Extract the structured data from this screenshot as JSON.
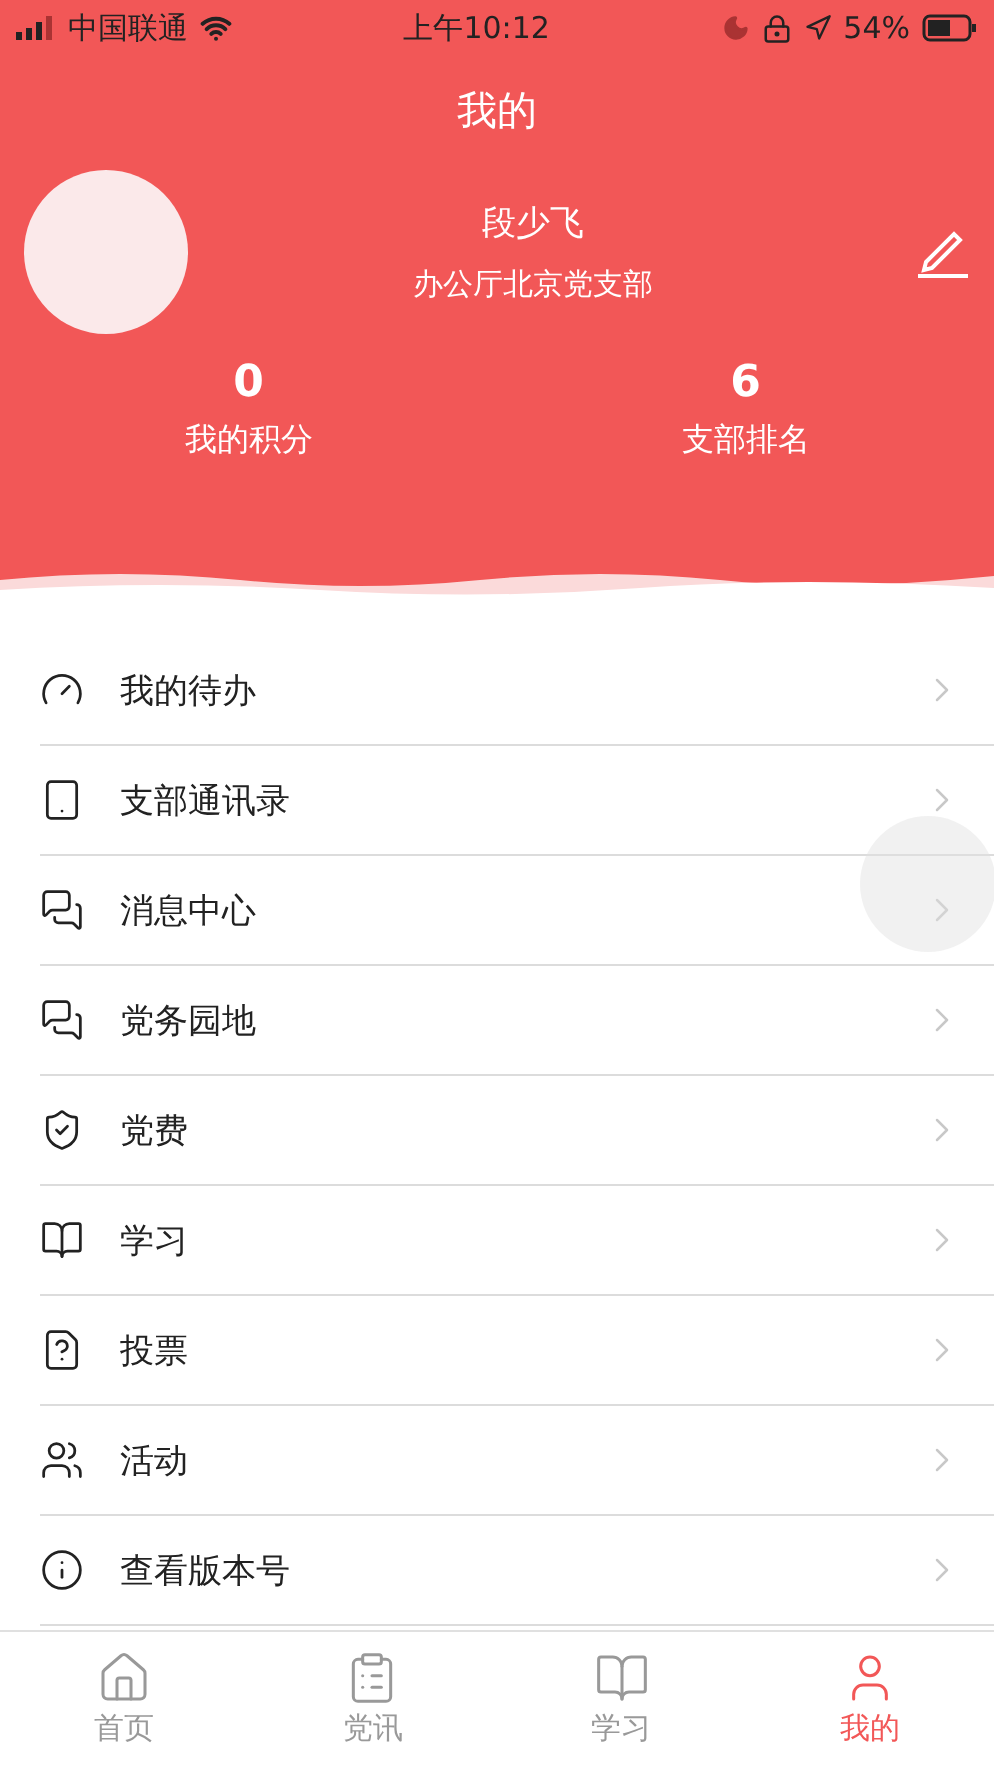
{
  "status_bar": {
    "carrier": "中国联通",
    "time": "上午10:12",
    "battery": "54%"
  },
  "header": {
    "title": "我的"
  },
  "profile": {
    "name": "段少飞",
    "branch": "办公厅北京党支部"
  },
  "stats": [
    {
      "value": "0",
      "label": "我的积分"
    },
    {
      "value": "6",
      "label": "支部排名"
    }
  ],
  "menu": [
    {
      "kind": "todo",
      "label": "我的待办"
    },
    {
      "kind": "contacts",
      "label": "支部通讯录"
    },
    {
      "kind": "messages",
      "label": "消息中心"
    },
    {
      "kind": "garden",
      "label": "党务园地"
    },
    {
      "kind": "fee",
      "label": "党费"
    },
    {
      "kind": "study",
      "label": "学习"
    },
    {
      "kind": "vote",
      "label": "投票"
    },
    {
      "kind": "activity",
      "label": "活动"
    },
    {
      "kind": "version",
      "label": "查看版本号"
    }
  ],
  "tabs": [
    {
      "kind": "home",
      "label": "首页",
      "selected": false
    },
    {
      "kind": "news",
      "label": "党讯",
      "selected": false
    },
    {
      "kind": "study",
      "label": "学习",
      "selected": false
    },
    {
      "kind": "me",
      "label": "我的",
      "selected": true
    }
  ]
}
